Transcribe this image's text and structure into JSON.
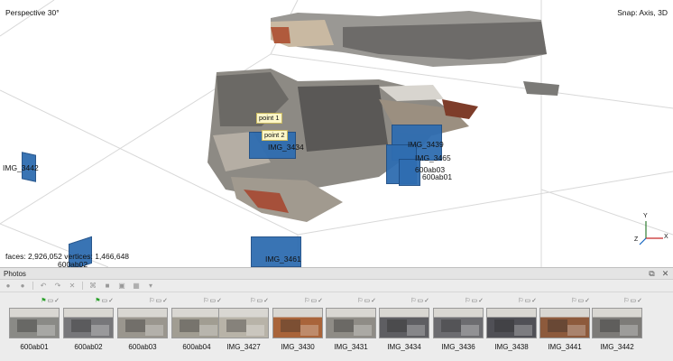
{
  "viewport": {
    "mode": "Perspective 30°",
    "snap": "Snap: Axis, 3D",
    "stats": "faces: 2,926,052 vertices: 1,466,648",
    "axes": {
      "y": "Y",
      "x": "X",
      "z": "Z"
    },
    "points": [
      "point 1",
      "point 2"
    ],
    "cameras": {
      "img3442": "IMG_3442",
      "img3434": "IMG_3434",
      "img3439": "IMG_3439",
      "img3465": "IMG_3465",
      "a603": "600ab03",
      "a601": "600ab01",
      "a602": "600ab02",
      "img3461": "IMG_3461"
    }
  },
  "photos": {
    "title": "Photos",
    "items": [
      {
        "label": "600ab01",
        "flag": "green",
        "tone": "#8a8a86"
      },
      {
        "label": "600ab02",
        "flag": "green",
        "tone": "#77777a"
      },
      {
        "label": "600ab03",
        "flag": "none",
        "tone": "#9a968e"
      },
      {
        "label": "600ab04",
        "flag": "none",
        "tone": "#a19d92"
      },
      {
        "label": "IMG_3427",
        "flag": "none",
        "tone": "#b8b3a8"
      },
      {
        "label": "IMG_3430",
        "flag": "none",
        "tone": "#a9643a"
      },
      {
        "label": "IMG_3431",
        "flag": "none",
        "tone": "#8f8c86"
      },
      {
        "label": "IMG_3434",
        "flag": "none",
        "tone": "#5e5e62"
      },
      {
        "label": "IMG_3436",
        "flag": "none",
        "tone": "#6c6c70"
      },
      {
        "label": "IMG_3438",
        "flag": "none",
        "tone": "#505056"
      },
      {
        "label": "IMG_3441",
        "flag": "none",
        "tone": "#8d5a3c"
      },
      {
        "label": "IMG_3442",
        "flag": "none",
        "tone": "#7d7b78"
      }
    ]
  },
  "colors": {
    "camera_blue": "#2f6db1",
    "flag_green": "#2da12d"
  }
}
